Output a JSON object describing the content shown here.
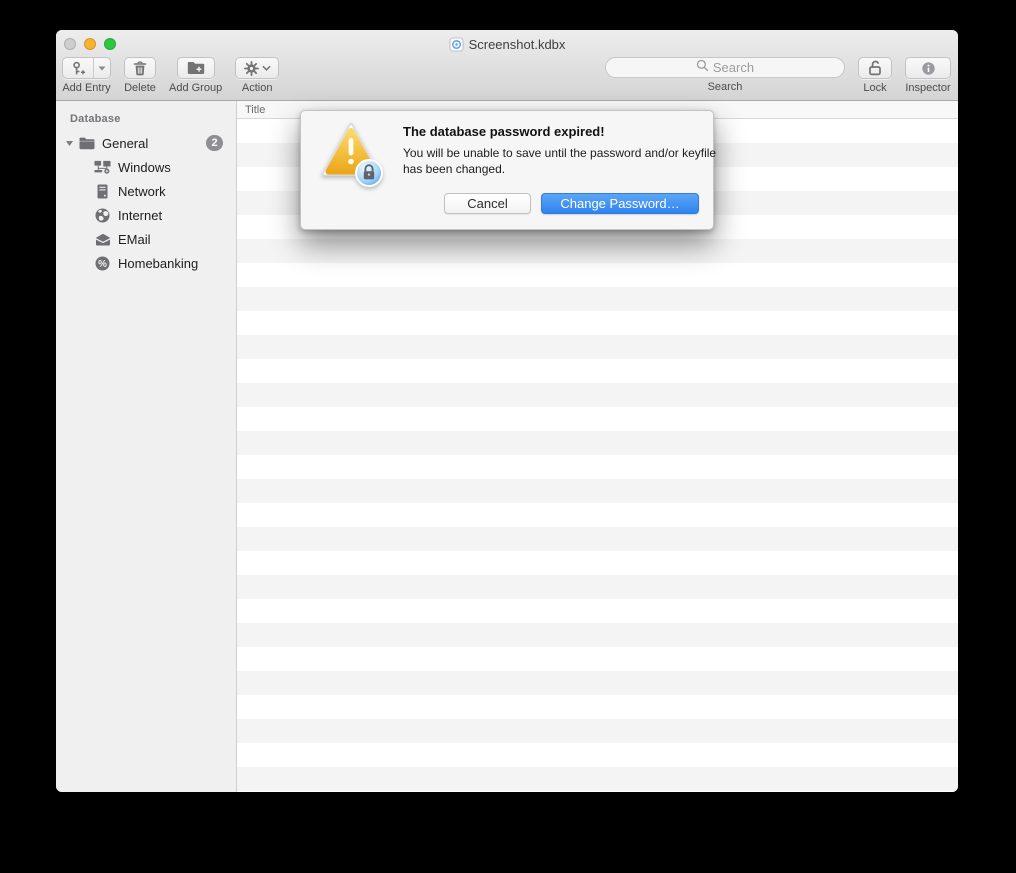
{
  "window": {
    "title": "Screenshot.kdbx",
    "title_icon": "doc-lock"
  },
  "traffic_lights": {
    "close_color": "#cecece",
    "minimize_color": "#f7b32f",
    "zoom_color": "#2ec73d"
  },
  "toolbar": {
    "add_entry_label": "Add Entry",
    "add_entry_icon": "key-plus",
    "add_entry_arrow_icon": "dropdown-arrow",
    "delete_label": "Delete",
    "delete_icon": "trash",
    "add_group_label": "Add Group",
    "add_group_icon": "folder-plus",
    "action_label": "Action",
    "action_icon": "gear",
    "action_arrow_icon": "chevron-down",
    "search_placeholder": "Search",
    "search_icon": "magnifier",
    "search_label": "Search",
    "lock_label": "Lock",
    "lock_icon": "padlock-open",
    "inspector_label": "Inspector",
    "inspector_icon": "info-circle"
  },
  "sidebar": {
    "section_header": "Database",
    "root_group": {
      "label": "General",
      "badge": "2",
      "icon": "folder",
      "disclosure_icon": "disclosure-down",
      "expanded": true
    },
    "groups": [
      {
        "label": "Windows",
        "icon": "workgroup"
      },
      {
        "label": "Network",
        "icon": "server"
      },
      {
        "label": "Internet",
        "icon": "globe"
      },
      {
        "label": "EMail",
        "icon": "envelope"
      },
      {
        "label": "Homebanking",
        "icon": "percent"
      }
    ]
  },
  "entry_list": {
    "column_title": "Title",
    "rows": [],
    "visible_stripe_rows": 29
  },
  "dialog": {
    "icon": "caution-lock",
    "title": "The database password expired!",
    "message": "You will be unable to save until the password and/or keyfile has been changed.",
    "cancel_label": "Cancel",
    "confirm_label": "Change Password…",
    "confirm_gradient_top": "#5ba6f7",
    "confirm_gradient_bottom": "#2f83ef",
    "caution_color": "#f0ab1f",
    "badge_color": "#3f9ff0"
  }
}
